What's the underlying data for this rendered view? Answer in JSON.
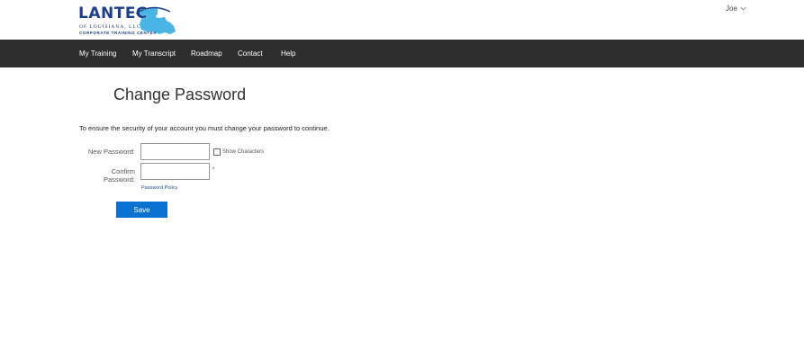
{
  "header": {
    "logo": {
      "name": "LANTEC",
      "sub": "OF LOUISIANA, LLC",
      "tagline": "CORPORATE TRAINING CENTER"
    },
    "user": {
      "name": "Joe",
      "icon": "chevron-down-icon"
    }
  },
  "nav": {
    "items": [
      {
        "label": "My Training"
      },
      {
        "label": "My Transcript"
      },
      {
        "label": "Roadmap"
      },
      {
        "label": "Contact"
      },
      {
        "label": "Help"
      }
    ]
  },
  "main": {
    "title": "Change Password",
    "instructions": "To ensure the security of your account you must change your password to continue.",
    "new_password": {
      "label": "New Password:",
      "value": ""
    },
    "show_characters": {
      "label": "Show Characters",
      "checked": false
    },
    "confirm_password": {
      "label": "Confirm Password:",
      "value": "",
      "required_marker": "*"
    },
    "policy_link": "Password Policy",
    "save_label": "Save"
  },
  "colors": {
    "navbar": "#2d2d2d",
    "primary_button": "#0a72d1",
    "logo": "#1d3f8a",
    "logo_state": "#29a8e0"
  }
}
